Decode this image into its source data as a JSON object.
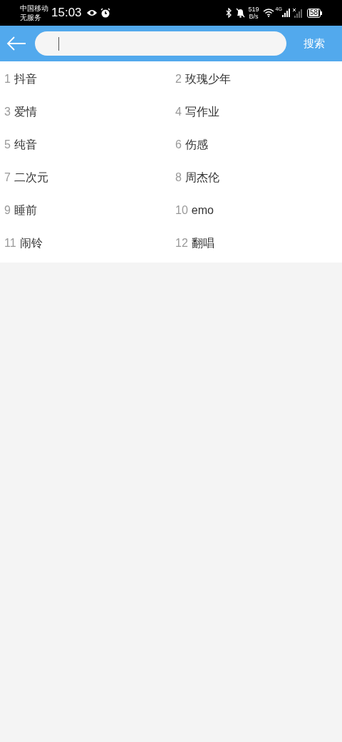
{
  "status_bar": {
    "carrier": "中国移动",
    "service": "无服务",
    "time": "15:03",
    "net_speed": "519",
    "net_unit": "B/s",
    "signal_label": "4G",
    "battery": "58"
  },
  "search_bar": {
    "button": "搜索"
  },
  "hot_searches": [
    {
      "rank": "1",
      "label": "抖音"
    },
    {
      "rank": "2",
      "label": "玫瑰少年"
    },
    {
      "rank": "3",
      "label": "爱情"
    },
    {
      "rank": "4",
      "label": "写作业"
    },
    {
      "rank": "5",
      "label": "纯音"
    },
    {
      "rank": "6",
      "label": "伤感"
    },
    {
      "rank": "7",
      "label": "二次元"
    },
    {
      "rank": "8",
      "label": "周杰伦"
    },
    {
      "rank": "9",
      "label": "睡前"
    },
    {
      "rank": "10",
      "label": "emo"
    },
    {
      "rank": "11",
      "label": "闹铃"
    },
    {
      "rank": "12",
      "label": "翻唱"
    }
  ]
}
